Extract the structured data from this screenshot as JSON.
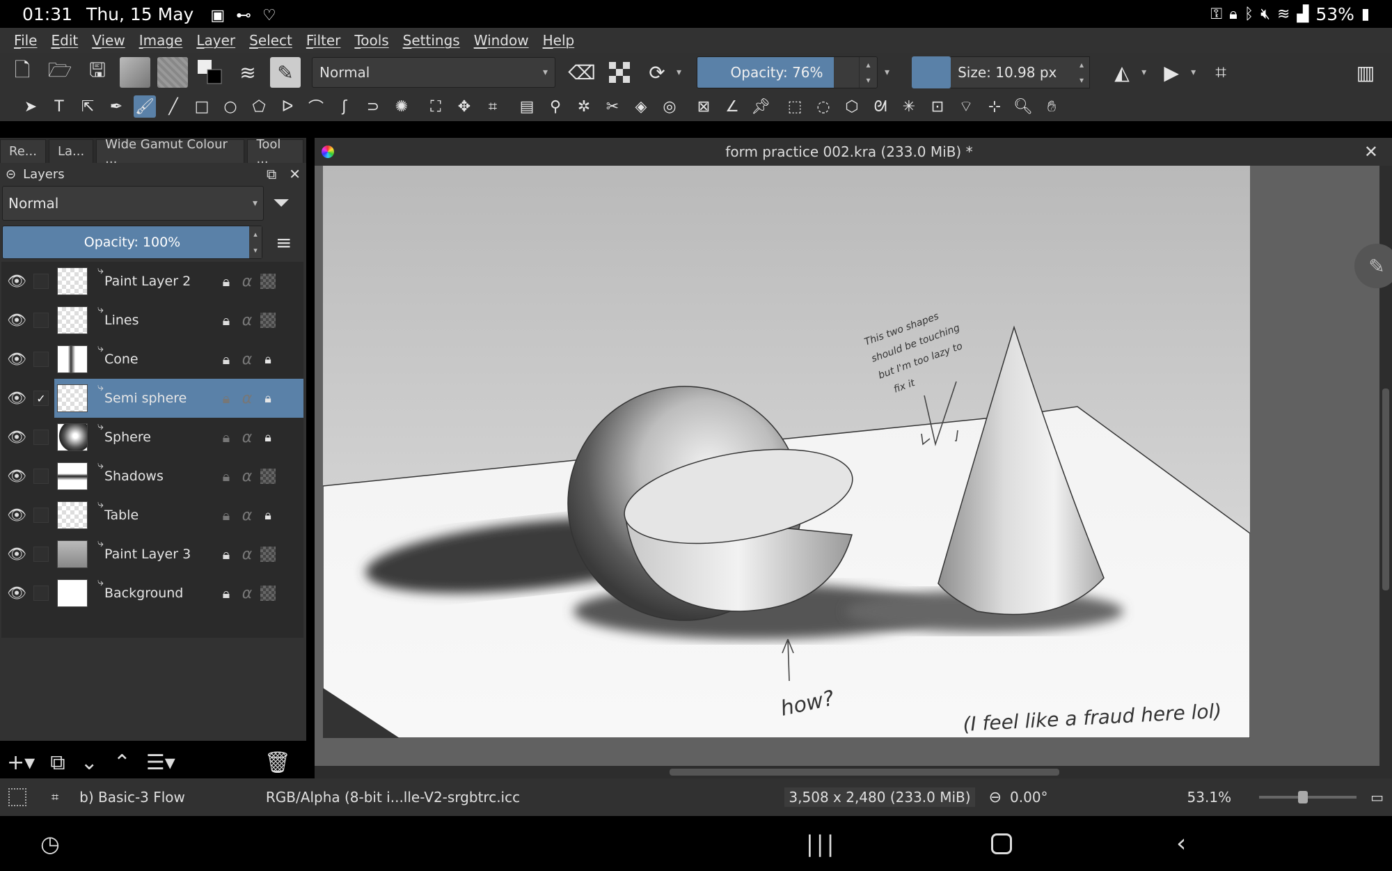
{
  "status_bar": {
    "time": "01:31",
    "date": "Thu, 15 May",
    "battery": "53%"
  },
  "menu": [
    "File",
    "Edit",
    "View",
    "Image",
    "Layer",
    "Select",
    "Filter",
    "Tools",
    "Settings",
    "Window",
    "Help"
  ],
  "toolbar": {
    "blend_mode": "Normal",
    "opacity_label": "Opacity: 76%",
    "opacity_value": 0.76,
    "size_label": "Size: 10.98 px"
  },
  "docker_tabs": [
    "Re...",
    "La...",
    "Wide Gamut Colour ...",
    "Tool ..."
  ],
  "layers_panel": {
    "title": "Layers",
    "blend_mode": "Normal",
    "opacity_label": "Opacity:  100%",
    "layers": [
      {
        "name": "Paint Layer 2",
        "selected": false
      },
      {
        "name": "Lines",
        "selected": false
      },
      {
        "name": "Cone",
        "selected": false
      },
      {
        "name": "Semi sphere",
        "selected": true
      },
      {
        "name": "Sphere",
        "selected": false
      },
      {
        "name": "Shadows",
        "selected": false
      },
      {
        "name": "Table",
        "selected": false
      },
      {
        "name": "Paint Layer 3",
        "selected": false
      },
      {
        "name": "Background",
        "selected": false
      }
    ]
  },
  "document": {
    "title": "form practice 002.kra (233.0 MiB) *",
    "annotations": {
      "note_top": [
        "This two shapes",
        "should be touching",
        "but I'm too lazy to",
        "fix it"
      ],
      "note_how": "how?",
      "note_bottom": "(I feel like a fraud here lol)"
    }
  },
  "statusbar": {
    "brush": "b) Basic-3 Flow",
    "color_profile": "RGB/Alpha (8-bit i...lle-V2-srgbtrc.icc",
    "dimensions": "3,508 x 2,480 (233.0 MiB)",
    "rotation": "0.00°",
    "zoom": "53.1%"
  },
  "colors": {
    "accent": "#5a81a8",
    "panel": "#323232",
    "canvas_bg": "#616161"
  }
}
